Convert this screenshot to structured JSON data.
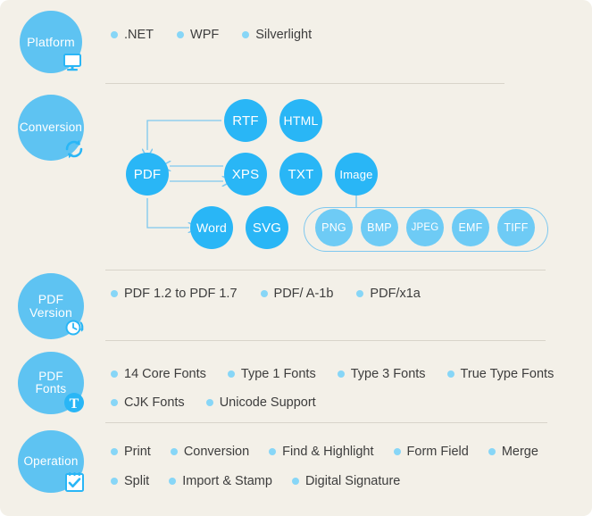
{
  "sections": [
    {
      "id": "platform",
      "badge": {
        "label": "Platform",
        "icon": "monitor-icon"
      },
      "rows": [
        [
          ".NET",
          "WPF",
          "Silverlight"
        ]
      ]
    },
    {
      "id": "conversion",
      "badge": {
        "label": "Conversion",
        "icon": "refresh-cycle-icon"
      },
      "diagram": {
        "nodes": [
          {
            "name": "RTF",
            "label": "RTF"
          },
          {
            "name": "HTML",
            "label": "HTML"
          },
          {
            "name": "PDF",
            "label": "PDF"
          },
          {
            "name": "XPS",
            "label": "XPS"
          },
          {
            "name": "TXT",
            "label": "TXT"
          },
          {
            "name": "Image",
            "label": "Image"
          },
          {
            "name": "Word",
            "label": "Word"
          },
          {
            "name": "SVG",
            "label": "SVG"
          }
        ],
        "image_formats": [
          "PNG",
          "BMP",
          "JPEG",
          "EMF",
          "TIFF"
        ]
      }
    },
    {
      "id": "pdf-version",
      "badge": {
        "label": "PDF\nVersion",
        "icon": "clock-history-icon"
      },
      "rows": [
        [
          "PDF 1.2 to PDF 1.7",
          "PDF/ A-1b",
          "PDF/x1a"
        ]
      ]
    },
    {
      "id": "pdf-fonts",
      "badge": {
        "label": "PDF Fonts",
        "icon": "type-t-icon"
      },
      "rows": [
        [
          "14 Core Fonts",
          "Type 1 Fonts",
          "Type 3 Fonts",
          "True Type Fonts"
        ],
        [
          "CJK Fonts",
          "Unicode Support"
        ]
      ]
    },
    {
      "id": "operation",
      "badge": {
        "label": "Operation",
        "icon": "checklist-icon"
      },
      "rows": [
        [
          "Print",
          "Conversion",
          "Find & Highlight",
          "Form Field",
          "Merge"
        ],
        [
          "Split",
          "Import & Stamp",
          "Digital Signature"
        ]
      ]
    }
  ],
  "colors": {
    "background": "#f3f0e8",
    "badge": "#5ec3f2",
    "node": "#29b6f6",
    "node_small": "#6ecbf5",
    "bullet": "#87d6f7",
    "arrow": "#7ec8ef",
    "separator": "#d8d4ca",
    "text": "#3d3d3d",
    "node_text": "#ffffff"
  }
}
